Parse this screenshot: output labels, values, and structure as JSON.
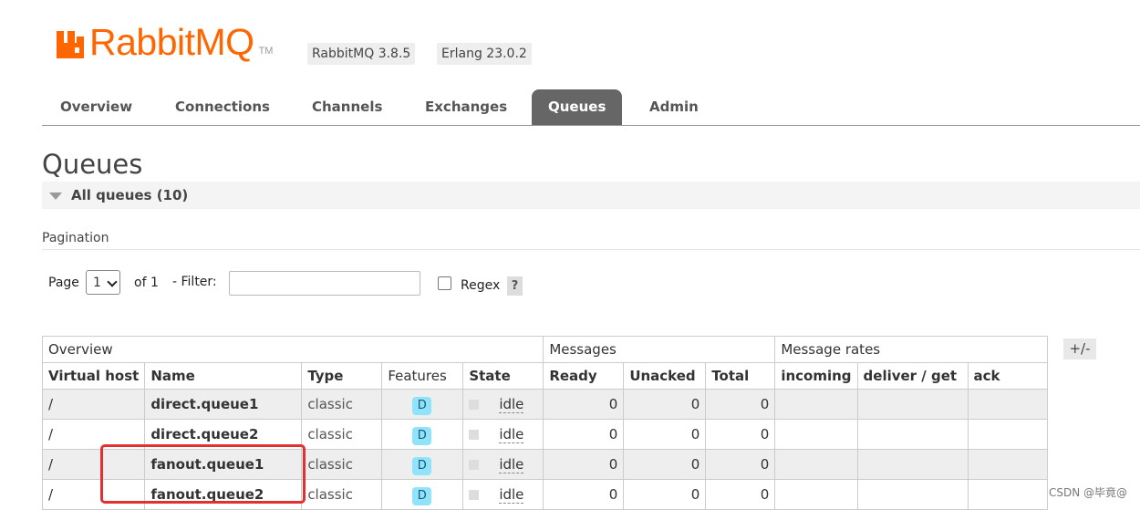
{
  "header": {
    "logo_text": "RabbitMQ",
    "logo_tm": "TM",
    "version_badge": "RabbitMQ 3.8.5",
    "erlang_badge": "Erlang 23.0.2"
  },
  "nav": {
    "tabs": [
      {
        "label": "Overview",
        "active": false
      },
      {
        "label": "Connections",
        "active": false
      },
      {
        "label": "Channels",
        "active": false
      },
      {
        "label": "Exchanges",
        "active": false
      },
      {
        "label": "Queues",
        "active": true
      },
      {
        "label": "Admin",
        "active": false
      }
    ]
  },
  "page": {
    "title": "Queues",
    "section_label": "All queues (10)",
    "pagination_label": "Pagination"
  },
  "controls": {
    "page_label": "Page",
    "page_value": "1",
    "of_label": "of 1",
    "filter_label": "- Filter:",
    "filter_value": "",
    "regex_label": "Regex",
    "regex_checked": false,
    "help_label": "?"
  },
  "table": {
    "groups": [
      "Overview",
      "Messages",
      "Message rates"
    ],
    "toggle_label": "+/-",
    "columns": [
      "Virtual host",
      "Name",
      "Type",
      "Features",
      "State",
      "Ready",
      "Unacked",
      "Total",
      "incoming",
      "deliver / get",
      "ack"
    ],
    "rows": [
      {
        "vhost": "/",
        "name": "direct.queue1",
        "type": "classic",
        "feature": "D",
        "state": "idle",
        "ready": "0",
        "unacked": "0",
        "total": "0",
        "incoming": "",
        "deliver_get": "",
        "ack": ""
      },
      {
        "vhost": "/",
        "name": "direct.queue2",
        "type": "classic",
        "feature": "D",
        "state": "idle",
        "ready": "0",
        "unacked": "0",
        "total": "0",
        "incoming": "",
        "deliver_get": "",
        "ack": ""
      },
      {
        "vhost": "/",
        "name": "fanout.queue1",
        "type": "classic",
        "feature": "D",
        "state": "idle",
        "ready": "0",
        "unacked": "0",
        "total": "0",
        "incoming": "",
        "deliver_get": "",
        "ack": ""
      },
      {
        "vhost": "/",
        "name": "fanout.queue2",
        "type": "classic",
        "feature": "D",
        "state": "idle",
        "ready": "0",
        "unacked": "0",
        "total": "0",
        "incoming": "",
        "deliver_get": "",
        "ack": ""
      }
    ]
  },
  "colors": {
    "brand": "#ff6600",
    "active_tab": "#666666",
    "badge": "#8fe4fb",
    "highlight": "#e3302f"
  },
  "watermark": "CSDN @毕竟@"
}
